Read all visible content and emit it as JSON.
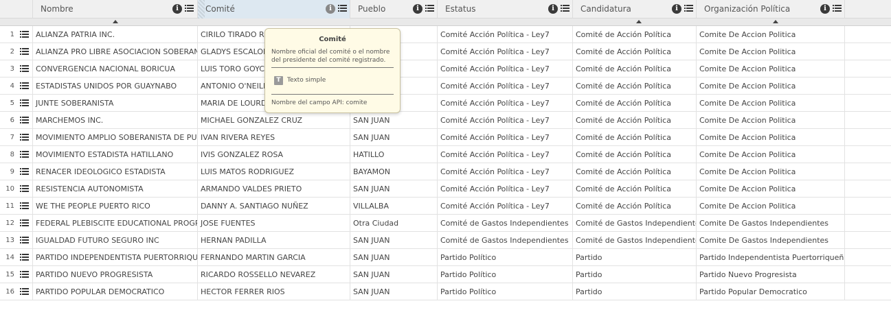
{
  "columns": [
    {
      "key": "nombre",
      "label": "Nombre"
    },
    {
      "key": "comite",
      "label": "Comité"
    },
    {
      "key": "pueblo",
      "label": "Pueblo"
    },
    {
      "key": "estatus",
      "label": "Estatus"
    },
    {
      "key": "candidatura",
      "label": "Candidatura"
    },
    {
      "key": "org",
      "label": "Organización Política"
    }
  ],
  "tooltip": {
    "title": "Comité",
    "description": "Nombre oficial del comité o el nombre del presidente del comité registrado.",
    "type_label": "Texto simple",
    "api_field": "Nombre del campo API: comite"
  },
  "rows": [
    {
      "n": "1",
      "nombre": "ALIANZA PATRIA INC.",
      "comite": "CIRILO TIRADO RIVERA",
      "pueblo": "",
      "estatus": "Comité Acción Política - Ley7",
      "candidatura": "Comité de Acción Política",
      "org": "Comite De Accion Politica"
    },
    {
      "n": "2",
      "nombre": "ALIANZA PRO LIBRE ASOCIACION SOBERANA INC.",
      "comite": "GLADYS ESCALONA DE MOTTA",
      "pueblo": "",
      "estatus": "Comité Acción Política - Ley7",
      "candidatura": "Comité de Acción Política",
      "org": "Comite De Accion Politica"
    },
    {
      "n": "3",
      "nombre": "CONVERGENCIA NACIONAL BORICUA",
      "comite": "LUIS TORO GOYCO",
      "pueblo": "",
      "estatus": "Comité Acción Política - Ley7",
      "candidatura": "Comité de Acción Política",
      "org": "Comite De Accion Politica"
    },
    {
      "n": "4",
      "nombre": "ESTADISTAS UNIDOS POR GUAYNABO",
      "comite": "ANTONIO O'NEILL",
      "pueblo": "",
      "estatus": "Comité Acción Política - Ley7",
      "candidatura": "Comité de Acción Política",
      "org": "Comite De Accion Politica"
    },
    {
      "n": "5",
      "nombre": "JUNTE SOBERANISTA",
      "comite": "MARIA DE LOURDES SANTIAGO",
      "pueblo": "",
      "estatus": "Comité Acción Política - Ley7",
      "candidatura": "Comité de Acción Política",
      "org": "Comite De Accion Politica"
    },
    {
      "n": "6",
      "nombre": "MARCHEMOS INC.",
      "comite": "MICHAEL GONZALEZ CRUZ",
      "pueblo": "SAN JUAN",
      "estatus": "Comité Acción Política - Ley7",
      "candidatura": "Comité de Acción Política",
      "org": "Comite De Accion Politica"
    },
    {
      "n": "7",
      "nombre": "MOVIMIENTO AMPLIO SOBERANISTA DE PUERTO RICO",
      "comite": "IVAN RIVERA REYES",
      "pueblo": "SAN JUAN",
      "estatus": "Comité Acción Política - Ley7",
      "candidatura": "Comité de Acción Política",
      "org": "Comite De Accion Politica"
    },
    {
      "n": "8",
      "nombre": "MOVIMIENTO ESTADISTA HATILLANO",
      "comite": "IVIS GONZALEZ ROSA",
      "pueblo": "HATILLO",
      "estatus": "Comité Acción Política - Ley7",
      "candidatura": "Comité de Acción Política",
      "org": "Comite De Accion Politica"
    },
    {
      "n": "9",
      "nombre": "RENACER IDEOLOGICO ESTADISTA",
      "comite": "LUIS MATOS RODRIGUEZ",
      "pueblo": "BAYAMON",
      "estatus": "Comité Acción Política - Ley7",
      "candidatura": "Comité de Acción Política",
      "org": "Comite De Accion Politica"
    },
    {
      "n": "10",
      "nombre": "RESISTENCIA AUTONOMISTA",
      "comite": "ARMANDO VALDES PRIETO",
      "pueblo": "SAN JUAN",
      "estatus": "Comité Acción Política - Ley7",
      "candidatura": "Comité de Acción Política",
      "org": "Comite De Accion Politica"
    },
    {
      "n": "11",
      "nombre": "WE THE PEOPLE PUERTO RICO",
      "comite": "DANNY A. SANTIAGO NUÑEZ",
      "pueblo": "VILLALBA",
      "estatus": "Comité Acción Política - Ley7",
      "candidatura": "Comité de Acción Política",
      "org": "Comite De Accion Politica"
    },
    {
      "n": "12",
      "nombre": "FEDERAL PLEBISCITE EDUCATIONAL PROGRAM",
      "comite": "JOSE FUENTES",
      "pueblo": "Otra Ciudad",
      "estatus": "Comité de Gastos Independientes",
      "candidatura": "Comité de Gastos Independientes",
      "org": "Comite De Gastos Independientes"
    },
    {
      "n": "13",
      "nombre": "IGUALDAD FUTURO SEGURO INC",
      "comite": "HERNAN PADILLA",
      "pueblo": "SAN JUAN",
      "estatus": "Comité de Gastos Independientes",
      "candidatura": "Comité de Gastos Independientes",
      "org": "Comite De Gastos Independientes"
    },
    {
      "n": "14",
      "nombre": "PARTIDO INDEPENDENTISTA PUERTORRIQUEÑO",
      "comite": "FERNANDO MARTIN GARCIA",
      "pueblo": "SAN JUAN",
      "estatus": "Partido Político",
      "candidatura": "Partido",
      "org": "Partido Independentista Puertorriqueño"
    },
    {
      "n": "15",
      "nombre": "PARTIDO NUEVO PROGRESISTA",
      "comite": "RICARDO ROSSELLO NEVAREZ",
      "pueblo": "SAN JUAN",
      "estatus": "Partido Político",
      "candidatura": "Partido",
      "org": "Partido Nuevo Progresista"
    },
    {
      "n": "16",
      "nombre": "PARTIDO POPULAR DEMOCRATICO",
      "comite": "HECTOR FERRER RIOS",
      "pueblo": "SAN JUAN",
      "estatus": "Partido Político",
      "candidatura": "Partido",
      "org": "Partido Popular Democratico"
    }
  ]
}
